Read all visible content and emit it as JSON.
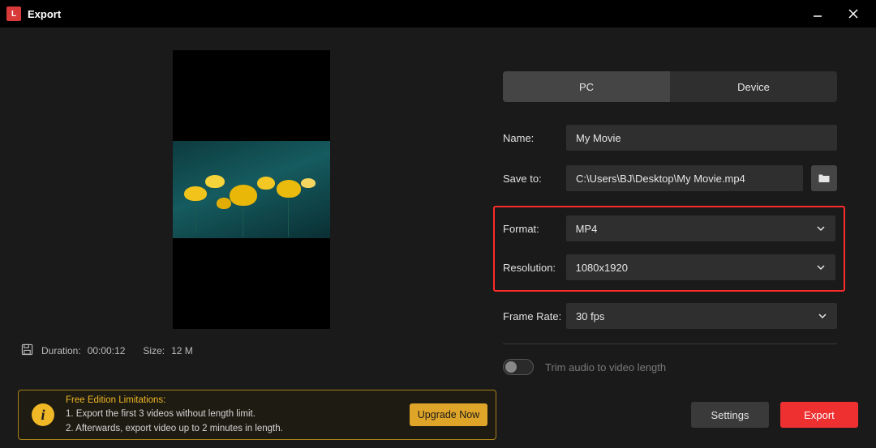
{
  "window": {
    "title": "Export"
  },
  "tabs": {
    "pc": "PC",
    "device": "Device"
  },
  "form": {
    "name_label": "Name:",
    "name_value": "My Movie",
    "save_label": "Save to:",
    "save_value": "C:\\Users\\BJ\\Desktop\\My Movie.mp4",
    "format_label": "Format:",
    "format_value": "MP4",
    "resolution_label": "Resolution:",
    "resolution_value": "1080x1920",
    "framerate_label": "Frame Rate:",
    "framerate_value": "30 fps",
    "trim_label": "Trim audio to video length"
  },
  "info": {
    "duration_label": "Duration:",
    "duration_value": "00:00:12",
    "size_label": "Size:",
    "size_value": "12 M"
  },
  "limitations": {
    "title": "Free Edition Limitations:",
    "line1": "1. Export the first 3 videos without length limit.",
    "line2": "2. Afterwards, export video up to 2 minutes in length.",
    "upgrade": "Upgrade Now"
  },
  "buttons": {
    "settings": "Settings",
    "export": "Export"
  }
}
